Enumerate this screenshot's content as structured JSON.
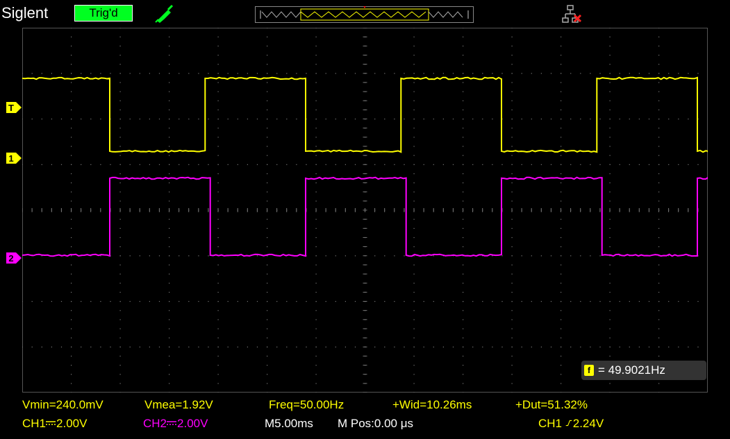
{
  "header": {
    "brand": "Siglent",
    "trigger_status": "Trig'd",
    "trigger_status_color": "#00ff21",
    "probe_icon": "probe-icon",
    "network_icon": "network-disconnected-icon"
  },
  "channels": [
    {
      "id": "1",
      "color": "#ffff00"
    },
    {
      "id": "2",
      "color": "#ff00ff"
    }
  ],
  "trigger_level_marker": "T",
  "trigger_position_marker": "T",
  "frequency_readout": {
    "badge": "f",
    "value": "= 49.9021Hz"
  },
  "measurements": {
    "vmin": "Vmin=240.0mV",
    "vmean": "Vmea=1.92V",
    "freq": "Freq=50.00Hz",
    "width": "+Wid=10.26ms",
    "duty": "+Dut=51.32%"
  },
  "status": {
    "ch1_label": "CH1",
    "ch1_scale": "2.00V",
    "ch2_label": "CH2",
    "ch2_scale": "2.00V",
    "timebase": "M5.00ms",
    "mpos": "M Pos:0.00 μs",
    "trig_source": "CH1",
    "trig_level": "2.24V"
  },
  "acquisition": {
    "waveform": "square",
    "period_ms": 20,
    "ch1_duty": 0.5132,
    "ch2_duty": 0.5132,
    "ch2_phase_ms": 10
  }
}
